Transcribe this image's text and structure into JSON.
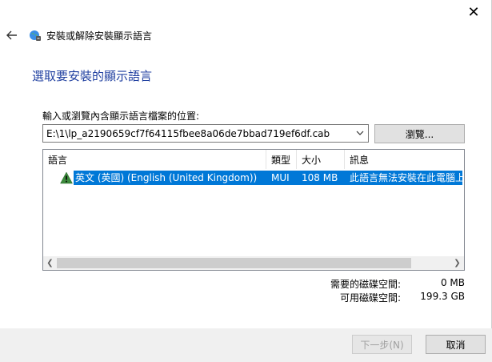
{
  "window": {
    "title": "安裝或解除安裝顯示語言"
  },
  "page": {
    "heading": "選取要安裝的顯示語言",
    "path_label": "輸入或瀏覽內含顯示語言檔案的位置:",
    "path_value": "E:\\1\\lp_a2190659cf7f64115fbee8a06de7bbad719ef6df.cab",
    "browse_label": "瀏覽..."
  },
  "list": {
    "columns": [
      "語言",
      "類型",
      "大小",
      "訊息"
    ],
    "rows": [
      {
        "language": "英文 (英國) (English (United Kingdom))",
        "type": "MUI",
        "size": "108 MB",
        "message": "此語言無法安裝在此電腦上",
        "status_icon": "warning-icon",
        "selected": true
      }
    ],
    "scroll_fraction_visible": 0.9
  },
  "space": {
    "required_label": "需要的磁碟空間:",
    "required_value": "0 MB",
    "available_label": "可用磁碟空間:",
    "available_value": "199.3 GB"
  },
  "footer": {
    "next_label": "下一步(N)",
    "cancel_label": "取消"
  },
  "colors": {
    "accent": "#0078d7",
    "heading": "#1f3fa0"
  }
}
